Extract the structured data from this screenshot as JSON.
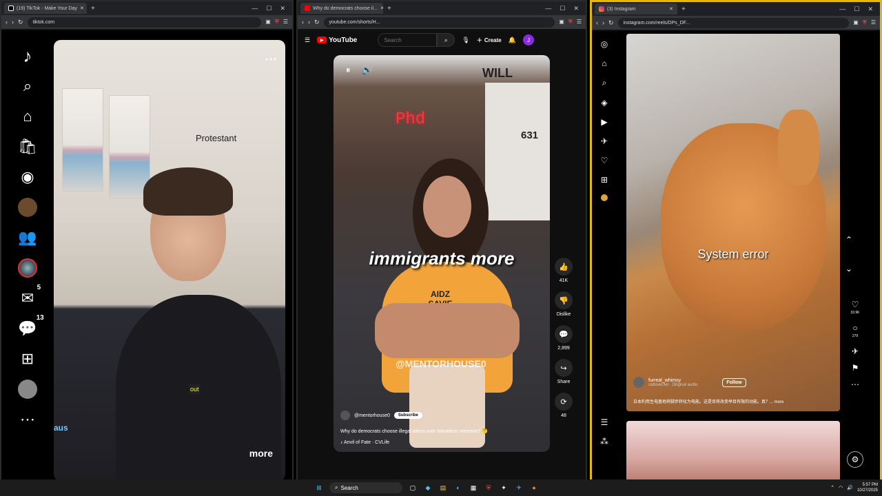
{
  "tiktok": {
    "tab_title": "(19) TikTok - Make Your Day",
    "url": "tiktok.com",
    "sidebar_badges": {
      "inbox": "5",
      "activity": "13"
    },
    "video_label": "Protestant",
    "more_label": "more",
    "aus_label": "aus",
    "overlay_text": "out"
  },
  "youtube": {
    "tab_title": "Why do democrats choose il...",
    "url": "youtube.com/shorts/H...",
    "brand": "YouTube",
    "search_placeholder": "Search",
    "create_label": "Create",
    "user_initial": "J",
    "caption": "immigrants more",
    "neon": "Phd",
    "address": "631",
    "street_sign": "WILL",
    "shirt_text": "AIDZ SAVIE",
    "watermark": "@MENTORHOUSE0",
    "channel": "@mentorhouse0",
    "subscribe": "Subscribe",
    "title": "Why do democrats choose illegal aliens over homeless veterans? 🤔",
    "music": "♪ Anvil of Fate · CVLife",
    "actions": [
      {
        "icon": "👍",
        "label": "41K"
      },
      {
        "icon": "👎",
        "label": "Dislike"
      },
      {
        "icon": "💬",
        "label": "2,899"
      },
      {
        "icon": "↪",
        "label": "Share"
      },
      {
        "icon": "⟳",
        "label": "48"
      }
    ]
  },
  "instagram": {
    "tab_title": "(3) Instagram",
    "url": "instagram.com/reels/DPs_DF...",
    "overlay": "System error",
    "username": "furreal_whimsy",
    "audio": "catlover3el · Original audio",
    "follow": "Follow",
    "caption": "日本利用生电基地将脚步转化为电能。这是否将改变举目有限的动能。真？... more",
    "counts": {
      "likes": "33.9K",
      "comments": "279"
    }
  },
  "taskbar": {
    "search": "Search",
    "time": "5:57 PM",
    "date": "10/27/2025"
  }
}
